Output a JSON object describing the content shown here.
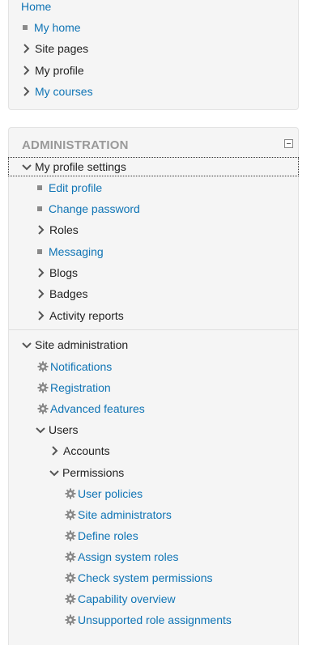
{
  "navigation": {
    "home": "Home",
    "my_home": "My home",
    "site_pages": "Site pages",
    "my_profile": "My profile",
    "my_courses": "My courses"
  },
  "administration": {
    "title": "ADMINISTRATION",
    "profile_settings": {
      "label": "My profile settings",
      "edit_profile": "Edit profile",
      "change_password": "Change password",
      "roles": "Roles",
      "messaging": "Messaging",
      "blogs": "Blogs",
      "badges": "Badges",
      "activity_reports": "Activity reports"
    },
    "site_admin": {
      "label": "Site administration",
      "notifications": "Notifications",
      "registration": "Registration",
      "advanced_features": "Advanced features",
      "users": {
        "label": "Users",
        "accounts": "Accounts",
        "permissions": {
          "label": "Permissions",
          "user_policies": "User policies",
          "site_administrators": "Site administrators",
          "define_roles": "Define roles",
          "assign_system_roles": "Assign system roles",
          "check_system_permissions": "Check system permissions",
          "capability_overview": "Capability overview",
          "unsupported_role_assignments": "Unsupported role assignments"
        }
      }
    }
  },
  "colors": {
    "link": "#0f74b5",
    "text": "#222222",
    "title": "#999999",
    "panel_bg": "#f5f5f5"
  }
}
